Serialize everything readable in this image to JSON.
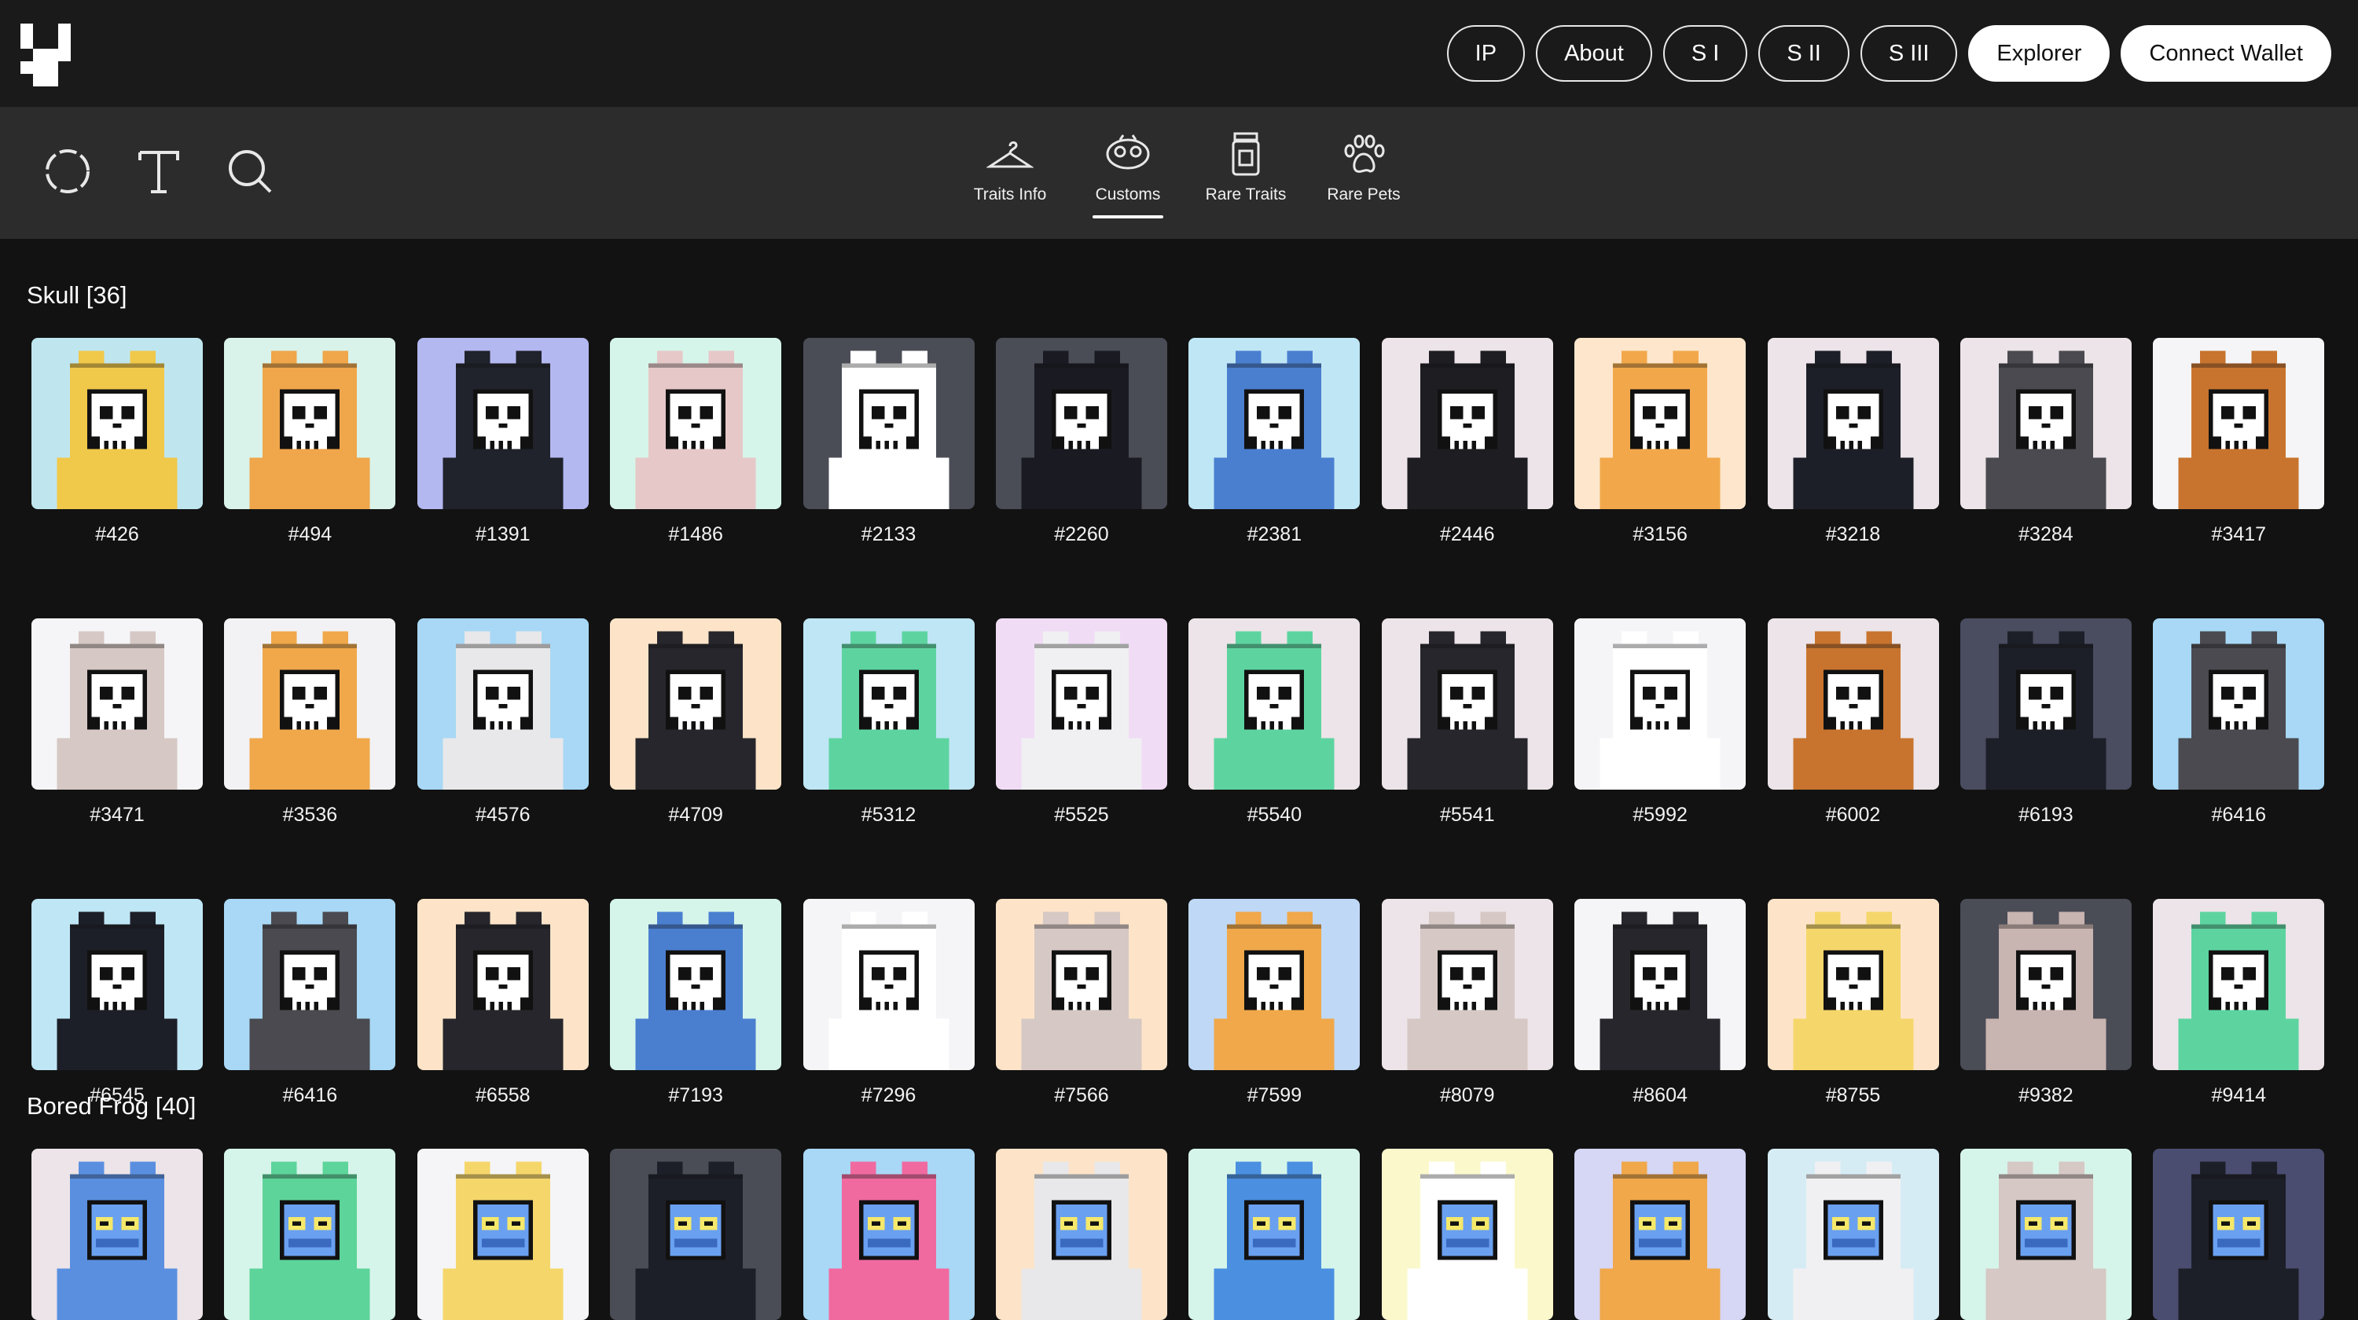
{
  "nav": {
    "buttons": [
      {
        "label": "IP",
        "style": "outline"
      },
      {
        "label": "About",
        "style": "outline"
      },
      {
        "label": "S I",
        "style": "outline"
      },
      {
        "label": "S II",
        "style": "outline"
      },
      {
        "label": "S III",
        "style": "outline"
      },
      {
        "label": "Explorer",
        "style": "solid"
      },
      {
        "label": "Connect Wallet",
        "style": "solid"
      }
    ]
  },
  "toolbar": {
    "tools": [
      "refresh-icon",
      "text-icon",
      "search-icon"
    ],
    "tabs": [
      {
        "label": "Traits Info",
        "icon": "hanger-icon",
        "active": false
      },
      {
        "label": "Customs",
        "icon": "customs-icon",
        "active": true
      },
      {
        "label": "Rare Traits",
        "icon": "jar-icon",
        "active": false
      },
      {
        "label": "Rare Pets",
        "icon": "paw-icon",
        "active": false
      }
    ]
  },
  "sections": [
    {
      "title": "Skull [36]",
      "face": "skull",
      "items": [
        {
          "id": "#426",
          "bg": "#bfe6ef",
          "costume": "#f0c84a",
          "costume_name": "yellow-leopard"
        },
        {
          "id": "#494",
          "bg": "#d9f3ea",
          "costume": "#f0a64a",
          "costume_name": "orange-dog"
        },
        {
          "id": "#1391",
          "bg": "#b4b8f0",
          "costume": "#20222c",
          "costume_name": "black-frog"
        },
        {
          "id": "#1486",
          "bg": "#d6f5ea",
          "costume": "#e6c8c8",
          "costume_name": "pink-shark"
        },
        {
          "id": "#2133",
          "bg": "#4a4c56",
          "costume": "#ffffff",
          "costume_name": "white-rabbit"
        },
        {
          "id": "#2260",
          "bg": "#4a4c56",
          "costume": "#1a1b22",
          "costume_name": "orca"
        },
        {
          "id": "#2381",
          "bg": "#bfe6f5",
          "costume": "#4a7fd0",
          "costume_name": "blue-dino"
        },
        {
          "id": "#2446",
          "bg": "#ece4e8",
          "costume": "#1d1d22",
          "costume_name": "black-gorilla"
        },
        {
          "id": "#3156",
          "bg": "#fde6cc",
          "costume": "#f2a84a",
          "costume_name": "orange-unicorn"
        },
        {
          "id": "#3218",
          "bg": "#ece4e8",
          "costume": "#1d1f28",
          "costume_name": "orca"
        },
        {
          "id": "#3284",
          "bg": "#ece4e8",
          "costume": "#4a4a50",
          "costume_name": "grey-leopard"
        },
        {
          "id": "#3417",
          "bg": "#f5f5f7",
          "costume": "#c8742e",
          "costume_name": "tiger"
        },
        {
          "id": "#3471",
          "bg": "#f5f5f7",
          "costume": "#d6c8c4",
          "costume_name": "grey-croc"
        },
        {
          "id": "#3536",
          "bg": "#f2f2f5",
          "costume": "#f0a84a",
          "costume_name": "orange-duck"
        },
        {
          "id": "#4576",
          "bg": "#a8d8f5",
          "costume": "#e8e8ea",
          "costume_name": "zebra"
        },
        {
          "id": "#4709",
          "bg": "#fde4c8",
          "costume": "#26262c",
          "costume_name": "black-monkey"
        },
        {
          "id": "#5312",
          "bg": "#bfe6f5",
          "costume": "#5dd4a0",
          "costume_name": "green-croc"
        },
        {
          "id": "#5525",
          "bg": "#f1dcf5",
          "costume": "#f0f0f2",
          "costume_name": "white-deer"
        },
        {
          "id": "#5540",
          "bg": "#ece4e8",
          "costume": "#5dd4a0",
          "costume_name": "green-croc"
        },
        {
          "id": "#5541",
          "bg": "#ece4e8",
          "costume": "#26262c",
          "costume_name": "black-leopard"
        },
        {
          "id": "#5992",
          "bg": "#f5f5f7",
          "costume": "#ffffff",
          "costume_name": "white-cat"
        },
        {
          "id": "#6002",
          "bg": "#ece4e8",
          "costume": "#c8742e",
          "costume_name": "tiger"
        },
        {
          "id": "#6193",
          "bg": "#4a4c60",
          "costume": "#1d1f28",
          "costume_name": "orca"
        },
        {
          "id": "#6416",
          "bg": "#a8d8f5",
          "costume": "#4a4a50",
          "costume_name": "grey-leopard"
        },
        {
          "id": "#6545",
          "bg": "#bfe6f5",
          "costume": "#1d1f28",
          "costume_name": "black-frog"
        },
        {
          "id": "#6416",
          "bg": "#a8d8f5",
          "costume": "#4a4a50",
          "costume_name": "grey-leopard"
        },
        {
          "id": "#6558",
          "bg": "#fde4c8",
          "costume": "#26262c",
          "costume_name": "black-monkey"
        },
        {
          "id": "#7193",
          "bg": "#d6f5ea",
          "costume": "#4a7fd0",
          "costume_name": "blue-dino"
        },
        {
          "id": "#7296",
          "bg": "#f5f5f7",
          "costume": "#ffffff",
          "costume_name": "white-rabbit"
        },
        {
          "id": "#7566",
          "bg": "#fde4c8",
          "costume": "#d6c8c4",
          "costume_name": "grey-croc"
        },
        {
          "id": "#7599",
          "bg": "#bfd8f5",
          "costume": "#f0a84a",
          "costume_name": "orange-leopard"
        },
        {
          "id": "#8079",
          "bg": "#ece4e8",
          "costume": "#d6c8c4",
          "costume_name": "pink-shark"
        },
        {
          "id": "#8604",
          "bg": "#f5f5f7",
          "costume": "#26262c",
          "costume_name": "black-monkey"
        },
        {
          "id": "#8755",
          "bg": "#fde4c8",
          "costume": "#f5d66a",
          "costume_name": "yellow-monkey"
        },
        {
          "id": "#9382",
          "bg": "#4a4c56",
          "costume": "#c8b4b0",
          "costume_name": "bull"
        },
        {
          "id": "#9414",
          "bg": "#ece4e8",
          "costume": "#5dd4a0",
          "costume_name": "green-croc"
        }
      ]
    },
    {
      "title": "Bored Frog [40]",
      "face": "frog",
      "items": [
        {
          "id": "",
          "bg": "#ece4e8",
          "costume": "#5a8fe0",
          "costume_name": "blue-shark"
        },
        {
          "id": "",
          "bg": "#d6f5ea",
          "costume": "#5dd49a",
          "costume_name": "green-frog"
        },
        {
          "id": "",
          "bg": "#f5f5f7",
          "costume": "#f5d66a",
          "costume_name": "yellow-monkey"
        },
        {
          "id": "",
          "bg": "#4a4c56",
          "costume": "#1d1f28",
          "costume_name": "black-frog"
        },
        {
          "id": "",
          "bg": "#a8d8f5",
          "costume": "#f06aa0",
          "costume_name": "pink-bird"
        },
        {
          "id": "",
          "bg": "#fde4c8",
          "costume": "#e8e8ea",
          "costume_name": "white-ram"
        },
        {
          "id": "",
          "bg": "#d6f5ea",
          "costume": "#4a8fe0",
          "costume_name": "blue-cat"
        },
        {
          "id": "",
          "bg": "#fbf8cc",
          "costume": "#ffffff",
          "costume_name": "white-cat"
        },
        {
          "id": "",
          "bg": "#d6d6f5",
          "costume": "#f0a84a",
          "costume_name": "orange-unicorn"
        },
        {
          "id": "",
          "bg": "#d6ecf5",
          "costume": "#f0f0f2",
          "costume_name": "white-monkey"
        },
        {
          "id": "",
          "bg": "#d6f5ea",
          "costume": "#d6c8c4",
          "costume_name": "pink-shark"
        },
        {
          "id": "",
          "bg": "#4a4c70",
          "costume": "#1d1f28",
          "costume_name": "penguin"
        }
      ]
    }
  ]
}
